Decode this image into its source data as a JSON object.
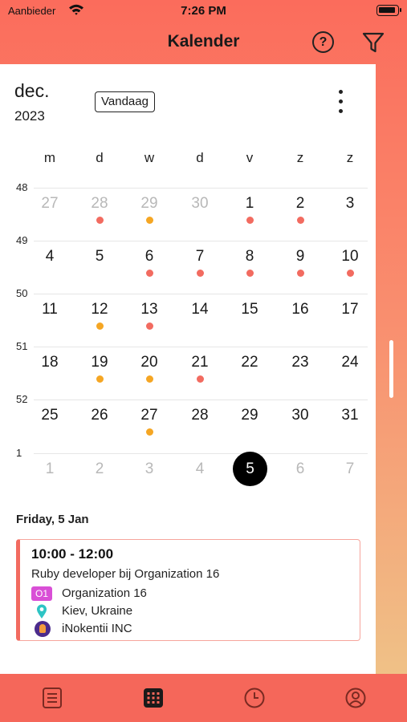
{
  "status": {
    "carrier": "Aanbieder",
    "time": "7:26 PM"
  },
  "nav": {
    "title": "Kalender",
    "help_label": "?"
  },
  "calendar": {
    "month": "dec.",
    "year": "2023",
    "today_button": "Vandaag",
    "weekdays": [
      "m",
      "d",
      "w",
      "d",
      "v",
      "z",
      "z"
    ],
    "weeks": [
      {
        "number": "48",
        "days": [
          {
            "label": "27",
            "muted": true
          },
          {
            "label": "28",
            "muted": true,
            "dot": "red"
          },
          {
            "label": "29",
            "muted": true,
            "dot": "orange"
          },
          {
            "label": "30",
            "muted": true
          },
          {
            "label": "1",
            "dot": "red"
          },
          {
            "label": "2",
            "dot": "red"
          },
          {
            "label": "3"
          }
        ]
      },
      {
        "number": "49",
        "days": [
          {
            "label": "4"
          },
          {
            "label": "5"
          },
          {
            "label": "6",
            "dot": "red"
          },
          {
            "label": "7",
            "dot": "red"
          },
          {
            "label": "8",
            "dot": "red"
          },
          {
            "label": "9",
            "dot": "red"
          },
          {
            "label": "10",
            "dot": "red"
          }
        ]
      },
      {
        "number": "50",
        "days": [
          {
            "label": "11"
          },
          {
            "label": "12",
            "dot": "orange"
          },
          {
            "label": "13",
            "dot": "red"
          },
          {
            "label": "14"
          },
          {
            "label": "15"
          },
          {
            "label": "16"
          },
          {
            "label": "17"
          }
        ]
      },
      {
        "number": "51",
        "days": [
          {
            "label": "18"
          },
          {
            "label": "19",
            "dot": "orange"
          },
          {
            "label": "20",
            "dot": "orange"
          },
          {
            "label": "21",
            "dot": "red"
          },
          {
            "label": "22"
          },
          {
            "label": "23"
          },
          {
            "label": "24"
          }
        ]
      },
      {
        "number": "52",
        "days": [
          {
            "label": "25"
          },
          {
            "label": "26"
          },
          {
            "label": "27",
            "dot": "orange"
          },
          {
            "label": "28"
          },
          {
            "label": "29"
          },
          {
            "label": "30"
          },
          {
            "label": "31"
          }
        ]
      },
      {
        "number": "1",
        "days": [
          {
            "label": "1",
            "muted": true
          },
          {
            "label": "2",
            "muted": true
          },
          {
            "label": "3",
            "muted": true
          },
          {
            "label": "4",
            "muted": true
          },
          {
            "label": "5",
            "selected": true
          },
          {
            "label": "6",
            "muted": true
          },
          {
            "label": "7",
            "muted": true
          }
        ]
      }
    ]
  },
  "agenda": {
    "date_label": "Friday, 5  Jan",
    "event": {
      "time": "10:00 - 12:00",
      "title": "Ruby developer bij Organization 16",
      "org_badge": "O1",
      "organization": "Organization 16",
      "location": "Kiev, Ukraine",
      "company": "iNokentii INC"
    }
  },
  "colors": {
    "accent": "#f5675a",
    "dot_red": "#f26b60",
    "dot_orange": "#f5a623",
    "org_badge": "#d94fd6",
    "location_icon": "#2ec4c4"
  },
  "tabs": [
    "list-icon",
    "calendar-grid-icon",
    "clock-icon",
    "profile-icon"
  ]
}
